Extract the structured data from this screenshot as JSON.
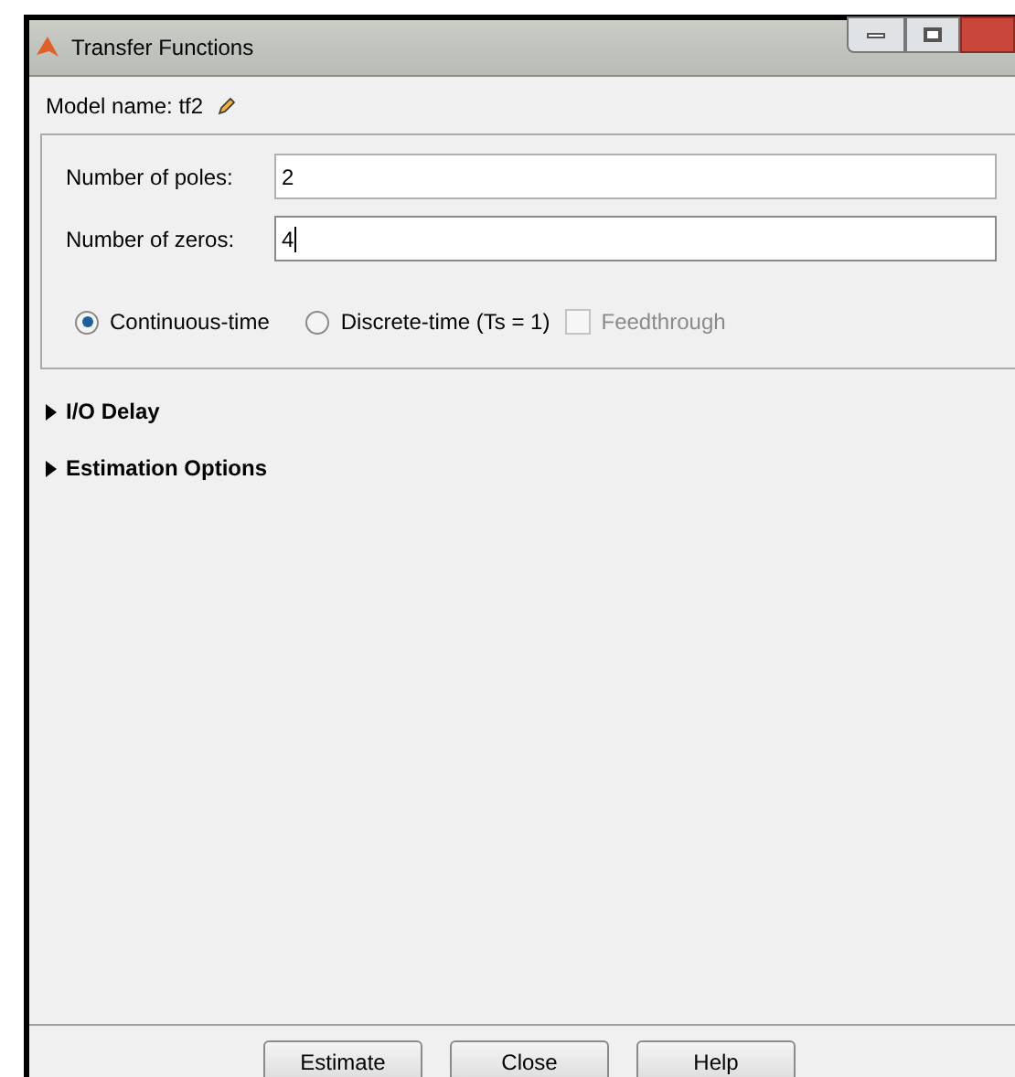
{
  "window": {
    "title": "Transfer Functions"
  },
  "model_name": "Model name: tf2",
  "fields": [
    {
      "label": "Number of poles:",
      "value": "2",
      "focused": false
    },
    {
      "label": "Number of zeros:",
      "value": "4",
      "focused": true
    }
  ],
  "time_options": [
    {
      "label": "Continuous-time",
      "selected": true
    },
    {
      "label": "Discrete-time (Ts = 1)",
      "selected": false
    }
  ],
  "feedthrough": {
    "label": "Feedthrough",
    "checked": false,
    "disabled": true
  },
  "sections": [
    {
      "label": "I/O Delay",
      "expanded": false
    },
    {
      "label": "Estimation Options",
      "expanded": false
    }
  ],
  "buttons": [
    "Estimate",
    "Close",
    "Help"
  ]
}
